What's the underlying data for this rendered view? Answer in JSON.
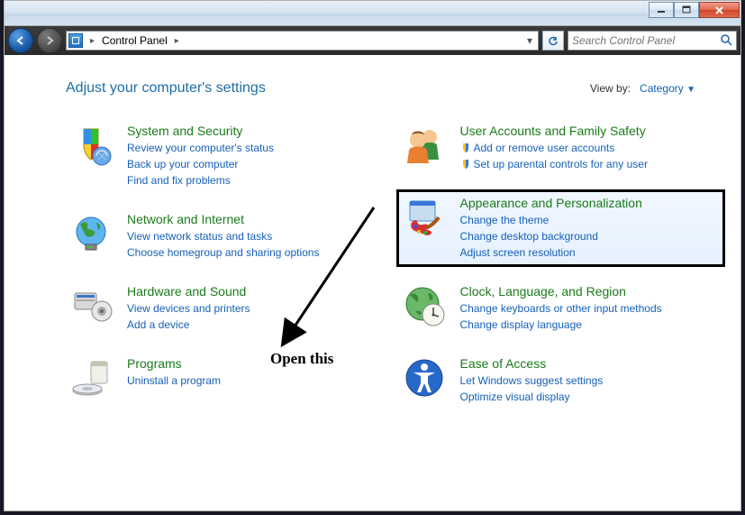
{
  "breadcrumb": {
    "root": "Control Panel"
  },
  "search": {
    "placeholder": "Search Control Panel"
  },
  "header": {
    "title": "Adjust your computer's settings",
    "viewByLabel": "View by:",
    "viewByValue": "Category"
  },
  "left": [
    {
      "title": "System and Security",
      "links": [
        {
          "t": "Review your computer's status",
          "s": false
        },
        {
          "t": "Back up your computer",
          "s": false
        },
        {
          "t": "Find and fix problems",
          "s": false
        }
      ]
    },
    {
      "title": "Network and Internet",
      "links": [
        {
          "t": "View network status and tasks",
          "s": false
        },
        {
          "t": "Choose homegroup and sharing options",
          "s": false
        }
      ]
    },
    {
      "title": "Hardware and Sound",
      "links": [
        {
          "t": "View devices and printers",
          "s": false
        },
        {
          "t": "Add a device",
          "s": false
        }
      ]
    },
    {
      "title": "Programs",
      "links": [
        {
          "t": "Uninstall a program",
          "s": false
        }
      ]
    }
  ],
  "right": [
    {
      "title": "User Accounts and Family Safety",
      "links": [
        {
          "t": "Add or remove user accounts",
          "s": true
        },
        {
          "t": "Set up parental controls for any user",
          "s": true
        }
      ]
    },
    {
      "title": "Appearance and Personalization",
      "highlight": true,
      "links": [
        {
          "t": "Change the theme",
          "s": false
        },
        {
          "t": "Change desktop background",
          "s": false
        },
        {
          "t": "Adjust screen resolution",
          "s": false
        }
      ]
    },
    {
      "title": "Clock, Language, and Region",
      "links": [
        {
          "t": "Change keyboards or other input methods",
          "s": false
        },
        {
          "t": "Change display language",
          "s": false
        }
      ]
    },
    {
      "title": "Ease of Access",
      "links": [
        {
          "t": "Let Windows suggest settings",
          "s": false
        },
        {
          "t": "Optimize visual display",
          "s": false
        }
      ]
    }
  ],
  "annotation": {
    "text": "Open this"
  }
}
